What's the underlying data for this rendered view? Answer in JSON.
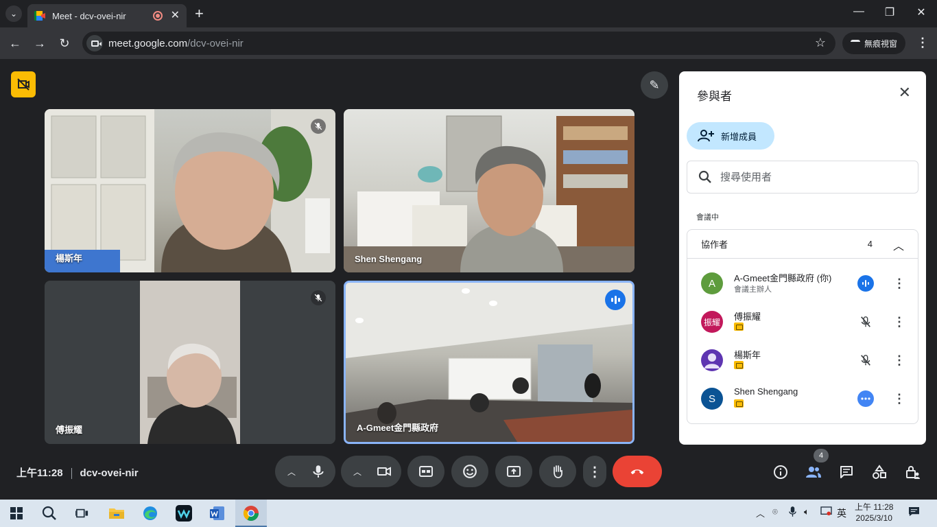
{
  "browser": {
    "tab_title": "Meet - dcv-ovei-nir",
    "url_host": "meet.google.com",
    "url_path": "/dcv-ovei-nir",
    "incognito_label": "無痕視窗"
  },
  "tiles": [
    {
      "name": "楊斯年",
      "muted": true
    },
    {
      "name": "Shen Shengang",
      "muted": false
    },
    {
      "name": "傅振耀",
      "muted": true
    },
    {
      "name": "A-Gmeet金門縣政府",
      "speaking": true
    }
  ],
  "panel": {
    "title": "參與者",
    "add_button": "新增成員",
    "search_placeholder": "搜尋使用者",
    "section": "會議中",
    "group_title": "協作者",
    "group_count": "4",
    "participants": [
      {
        "initial": "A",
        "name": "A-Gmeet金門縣政府 (你)",
        "sub": "會議主辦人",
        "color": "#5e9c3d",
        "state": "speaking"
      },
      {
        "initial": "振耀",
        "name": "傅振耀",
        "color": "#c2185b",
        "state": "muted"
      },
      {
        "initial": "",
        "name": "楊斯年",
        "color": "#5e35b1",
        "state": "muted"
      },
      {
        "initial": "S",
        "name": "Shen Shengang",
        "color": "#0b5394",
        "state": "more"
      }
    ]
  },
  "controls": {
    "time": "上午11:28",
    "meeting_code": "dcv-ovei-nir",
    "people_count": "4"
  },
  "taskbar": {
    "ime": "英",
    "time": "上午 11:28",
    "date": "2025/3/10"
  }
}
